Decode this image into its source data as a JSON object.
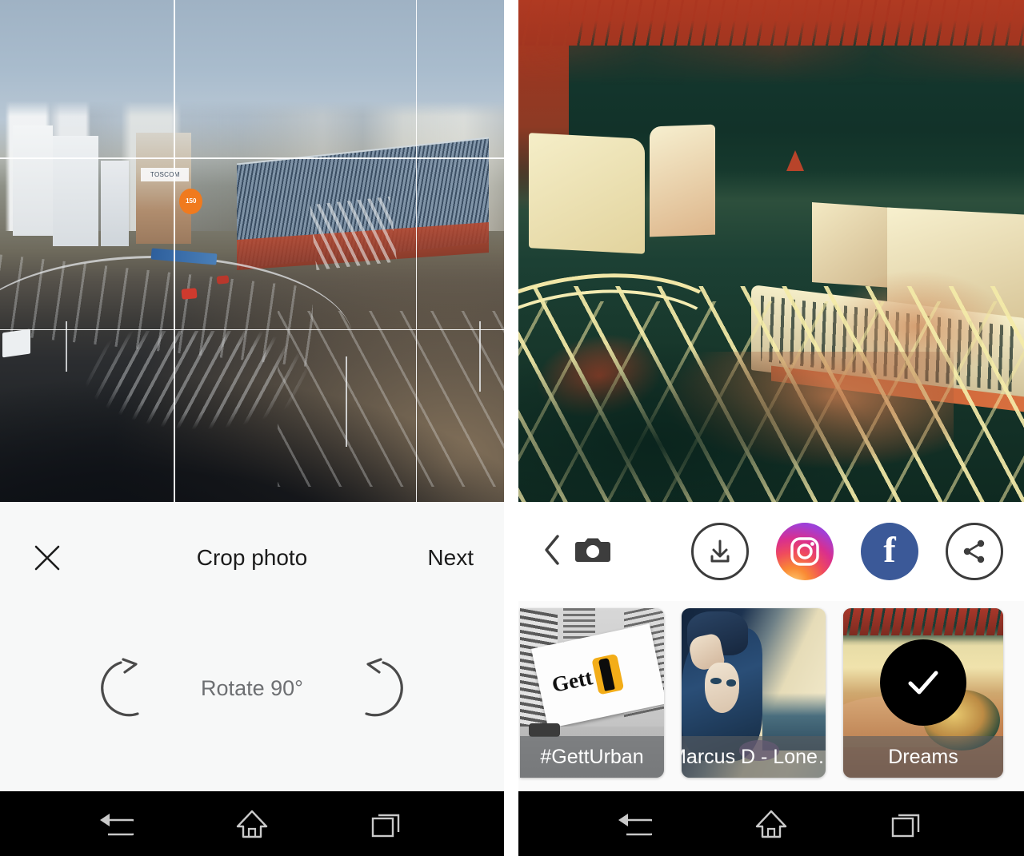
{
  "left_screen": {
    "crop_editor": {
      "close_icon": "close-x-icon",
      "title": "Crop photo",
      "next_label": "Next",
      "rotate_label": "Rotate 90°",
      "rotate_cw_icon": "rotate-clockwise-icon",
      "rotate_ccw_icon": "rotate-counterclockwise-icon",
      "grid_overlay": "rule-of-thirds",
      "photo_alt": "aerial city photo of tram roundabout and railway station"
    },
    "navbar": {
      "back_icon": "back-arrow-icon",
      "home_icon": "home-icon",
      "recents_icon": "recent-apps-icon"
    }
  },
  "right_screen": {
    "result": {
      "photo_alt": "stylized painterly render of the city scene"
    },
    "share_bar": {
      "back_icon": "chevron-left-icon",
      "camera_icon": "camera-icon",
      "download_icon": "download-icon",
      "instagram_icon": "instagram-icon",
      "facebook_icon": "facebook-icon",
      "facebook_glyph": "f",
      "share_icon": "share-icon"
    },
    "filters": [
      {
        "label": "#GettUrban",
        "selected": false
      },
      {
        "label": "Marcus D - Lone…",
        "selected": false
      },
      {
        "label": "Dreams",
        "selected": true,
        "check_icon": "check-icon"
      }
    ],
    "navbar": {
      "back_icon": "back-arrow-icon",
      "home_icon": "home-icon",
      "recents_icon": "recent-apps-icon"
    }
  },
  "colors": {
    "toolbar_bg": "#f7f8f8",
    "text_primary": "#1c1c1c",
    "text_secondary": "#6d6f72",
    "navbar_bg": "#000000",
    "facebook_blue": "#3b5998",
    "caption_overlay": "rgba(88,92,96,0.62)",
    "check_badge": "#000000"
  }
}
